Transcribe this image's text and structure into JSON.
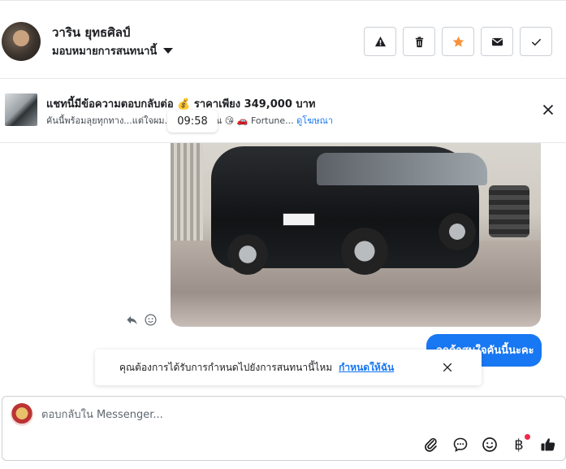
{
  "header": {
    "name": "วาริน ยุทธศิลป์",
    "assign_label": "มอบหมายการสนทนานี้",
    "actions": [
      {
        "icon": "warning-icon",
        "label": "Report"
      },
      {
        "icon": "trash-icon",
        "label": "Delete"
      },
      {
        "icon": "star-icon",
        "label": "Star"
      },
      {
        "icon": "envelope-icon",
        "label": "Mark unread"
      },
      {
        "icon": "check-icon",
        "label": "Done"
      }
    ],
    "star_color": "#f7923b"
  },
  "banner": {
    "title": "แชทนี้มีข้อความตอบกลับต่อ 💰 ราคาเพียง 349,000 บาท",
    "subtitle": "คันนี้พร้อมลุยทุกทาง...แต่ใจผม...ครั้งที่เจอคุณ 😘 🚗 Fortune...",
    "link": "ดูโฆษณา",
    "timestamp": "09:58"
  },
  "chat": {
    "outgoing_text": "ลูกค้าสนใจคันนี้นะคะ",
    "accent": "#1877f2"
  },
  "notice": {
    "text": "คุณต้องการได้รับการกำหนดไปยังการสนทนานี้ไหม",
    "link": "กำหนดให้ฉัน"
  },
  "composer": {
    "placeholder": "ตอบกลับใน Messenger...",
    "tools": [
      "paperclip-icon",
      "chat-bubble-icon",
      "smiley-icon",
      "baht-icon",
      "thumbs-up-icon"
    ]
  }
}
